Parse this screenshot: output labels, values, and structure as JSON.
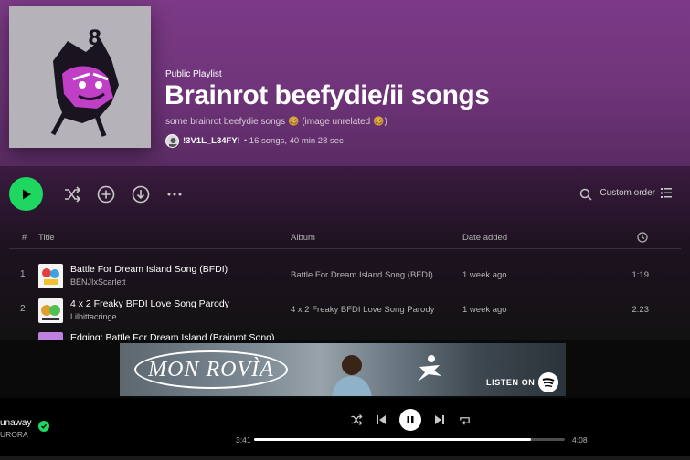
{
  "playlist": {
    "type_label": "Public Playlist",
    "title": "Brainrot beefydie/ii songs",
    "description": "some brainrot beefydie songs 🥴 (image unrelated 🥴)",
    "owner": "!3V1L_L34FY!",
    "meta": "• 16 songs, 40 min 28 sec"
  },
  "actions": {
    "play_icon": "play-icon",
    "shuffle_icon": "shuffle-icon",
    "add_icon": "add-circle-icon",
    "download_icon": "download-icon",
    "more_icon": "more-icon",
    "search_icon": "search-icon",
    "sort_label": "Custom order",
    "sort_icon": "list-icon"
  },
  "table": {
    "headers": {
      "number": "#",
      "title": "Title",
      "album": "Album",
      "date_added": "Date added",
      "duration_icon": "clock-icon"
    },
    "rows": [
      {
        "number": "1",
        "title": "Battle For Dream Island Song (BFDI)",
        "artist": "BENJIxScarlett",
        "album": "Battle For Dream Island Song (BFDI)",
        "date_added": "1 week ago",
        "duration": "1:19"
      },
      {
        "number": "2",
        "title": "4 x 2 Freaky BFDI Love Song Parody",
        "artist": "Lilbittacringe",
        "album": "4 x 2 Freaky BFDI Love Song Parody",
        "date_added": "1 week ago",
        "duration": "2:23"
      }
    ],
    "partial_row_title": "Edging: Battle For Dream Island (Brainrot Song)"
  },
  "ad": {
    "brand": "MON ROVÌA",
    "listen_on": "LISTEN ON"
  },
  "player": {
    "track_title": "unaway",
    "track_artist": "URORA",
    "time_current": "3:41",
    "time_total": "4:08",
    "progress": 0.89
  },
  "colors": {
    "accent": "#1ed760",
    "header": "#7d3a87"
  }
}
